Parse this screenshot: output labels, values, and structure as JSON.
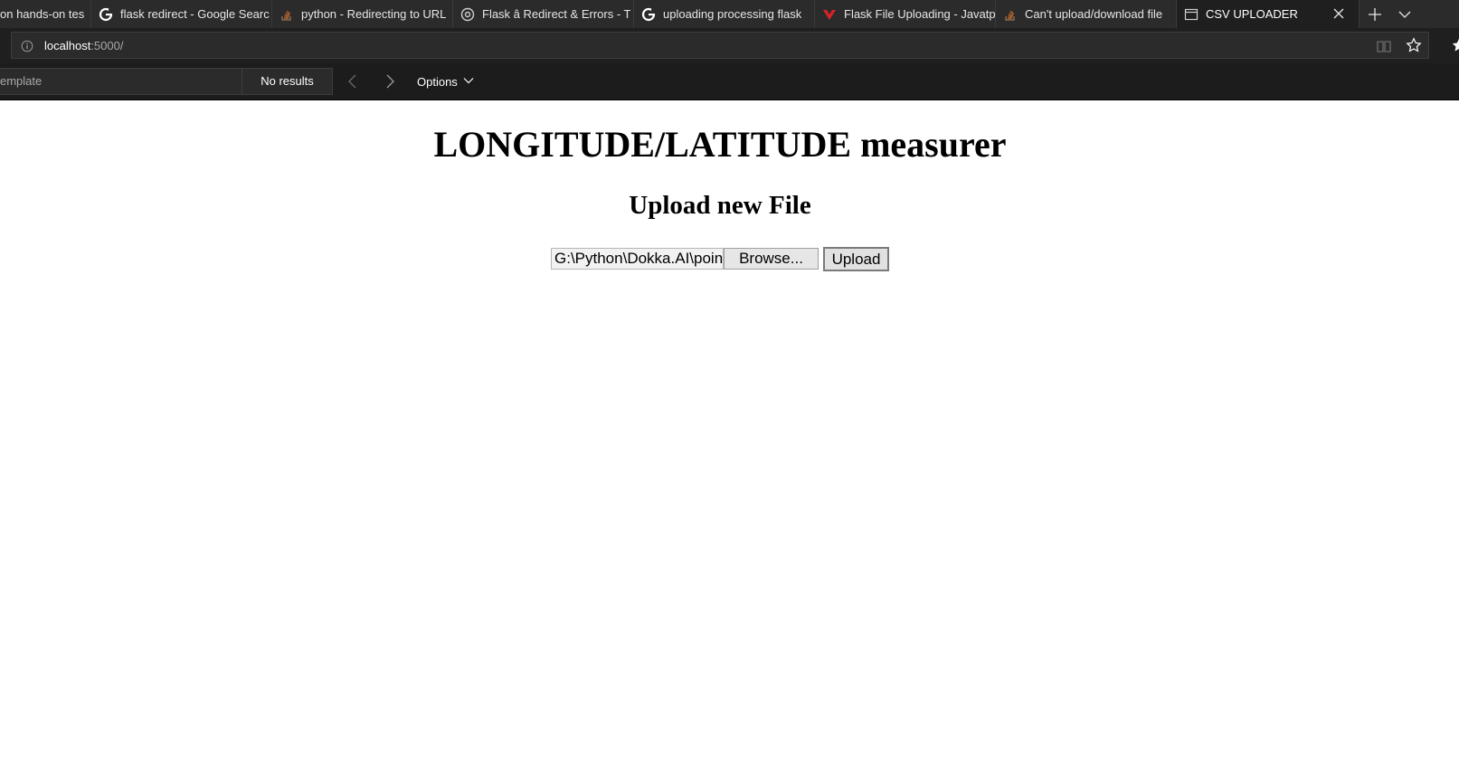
{
  "browser": {
    "tabs": [
      {
        "title": "on hands-on tes",
        "icon": "stackoverflow-icon"
      },
      {
        "title": "flask redirect - Google Searc",
        "icon": "google-icon"
      },
      {
        "title": "python - Redirecting to URL",
        "icon": "stackoverflow-icon"
      },
      {
        "title": "Flask â Redirect & Errors - T",
        "icon": "tutorialspoint-icon"
      },
      {
        "title": "uploading processing flask",
        "icon": "google-icon"
      },
      {
        "title": "Flask File Uploading - Javatp",
        "icon": "javatpoint-icon"
      },
      {
        "title": "Can't upload/download file",
        "icon": "stackoverflow-icon"
      },
      {
        "title": "CSV UPLOADER",
        "icon": "page-icon",
        "active": true
      }
    ],
    "address": {
      "host": "localhost",
      "path": ":5000/"
    },
    "find": {
      "query": "emplate",
      "results": "No results",
      "options_label": "Options"
    }
  },
  "page": {
    "heading": "LONGITUDE/LATITUDE measurer",
    "subheading": "Upload new File",
    "file_path": "G:\\Python\\Dokka.AI\\points.csv",
    "browse_label": "Browse...",
    "upload_label": "Upload"
  },
  "colors": {
    "chrome_dark": "#2b2b2b",
    "active_tab": "#1f1f1f",
    "page_background": "#ffffff"
  }
}
